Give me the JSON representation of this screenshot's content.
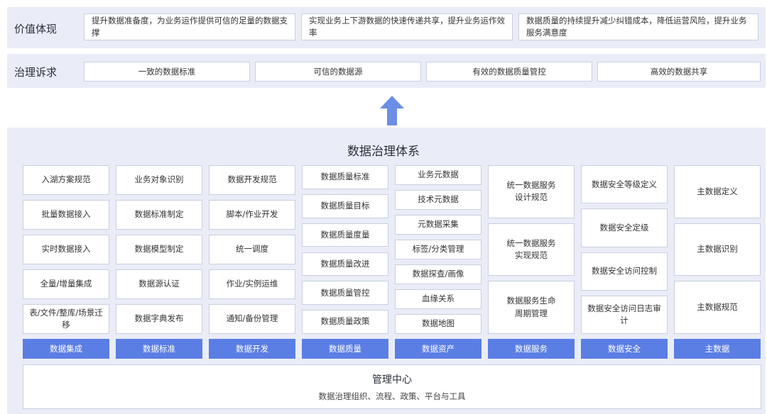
{
  "value_row": {
    "label": "价值体现",
    "items": [
      "提升数据准备度，为业务运作提供可信的足量的数据支撑",
      "实现业务上下游数据的快速传递共享，提升业务运作效率",
      "数据质量的持续提升减少纠错成本，降低运营风险，提升业务服务满意度"
    ]
  },
  "demand_row": {
    "label": "治理诉求",
    "items": [
      "一致的数据标准",
      "可信的数据源",
      "有效的数据质量管控",
      "高效的数据共享"
    ]
  },
  "system": {
    "title": "数据治理体系",
    "columns": [
      {
        "footer": "数据集成",
        "cells": [
          "入湖方案规范",
          "批量数据接入",
          "实时数据接入",
          "全量/增量集成",
          "表/文件/整库/场景迁移"
        ]
      },
      {
        "footer": "数据标准",
        "cells": [
          "业务对象识别",
          "数据标准制定",
          "数据模型制定",
          "数据源认证",
          "数据字典发布"
        ]
      },
      {
        "footer": "数据开发",
        "cells": [
          "数据开发规范",
          "脚本/作业开发",
          "统一调度",
          "作业/实例运维",
          "通知/备份管理"
        ]
      },
      {
        "footer": "数据质量",
        "cells": [
          "数据质量标准",
          "数据质量目标",
          "数据质量度量",
          "数据质量改进",
          "数据质量管控",
          "数据质量政策"
        ]
      },
      {
        "footer": "数据资产",
        "cells": [
          "业务元数据",
          "技术元数据",
          "元数据采集",
          "标签/分类管理",
          "数据探查/画像",
          "血缘关系",
          "数据地图"
        ]
      },
      {
        "footer": "数据服务",
        "cells": [
          "统一数据服务\n设计规范",
          "统一数据服务\n实现规范",
          "数据服务生命\n周期管理"
        ]
      },
      {
        "footer": "数据安全",
        "cells": [
          "数据安全等级定义",
          "数据安全定级",
          "数据安全访问控制",
          "数据安全访问日志审计"
        ]
      },
      {
        "footer": "主数据",
        "cells": [
          "主数据定义",
          "主数据识别",
          "主数据规范"
        ]
      }
    ]
  },
  "management_center": {
    "title": "管理中心",
    "subtitle": "数据治理组织、流程、政策、平台与工具"
  },
  "colors": {
    "band": "#eaedf7",
    "accent": "#5b7ee5",
    "arrow": "#6d8ee6",
    "border": "#c9cfe0"
  }
}
